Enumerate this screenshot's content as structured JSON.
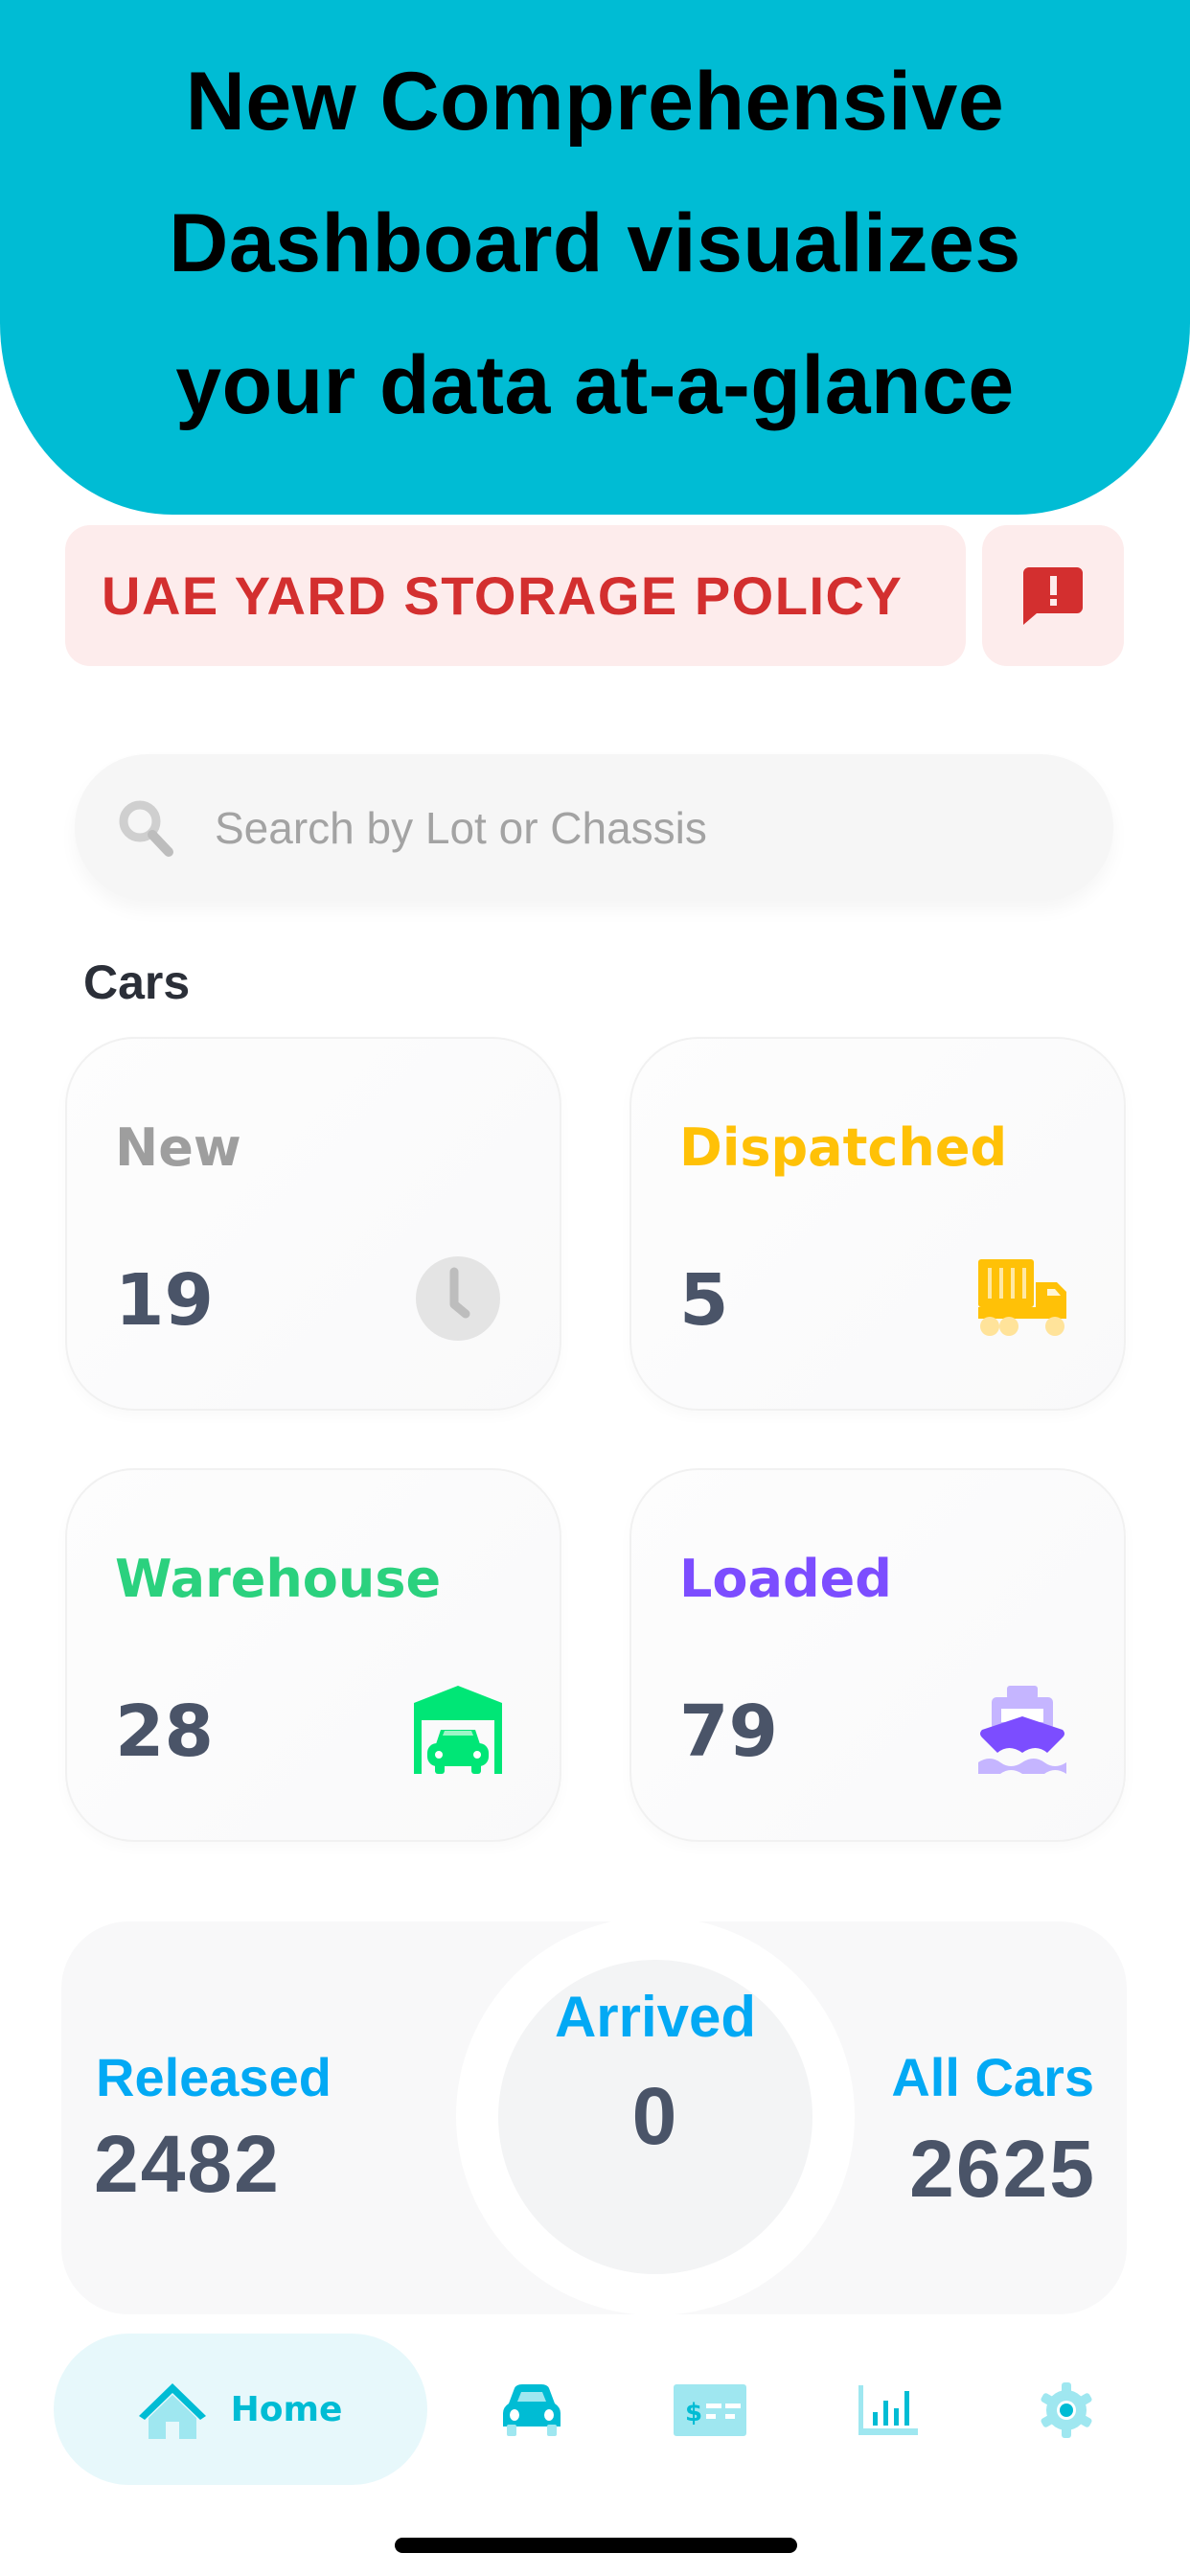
{
  "hero": {
    "lines": [
      "New Comprehensive",
      "Dashboard visualizes",
      "your data at-a-glance"
    ],
    "background": "#00BCD4"
  },
  "policy_banner": {
    "label": "UAE YARD STORAGE POLICY",
    "alert_icon": "alert-message-icon",
    "color": "#D32F2F"
  },
  "search": {
    "placeholder": "Search by Lot or Chassis",
    "value": "",
    "icon": "search-icon"
  },
  "cars": {
    "title": "Cars",
    "cards": [
      {
        "label": "New",
        "value": "19",
        "color": "#9E9E9E",
        "icon": "clock-icon"
      },
      {
        "label": "Dispatched",
        "value": "5",
        "color": "#FFC107",
        "icon": "truck-icon"
      },
      {
        "label": "Warehouse",
        "value": "28",
        "color": "#2BD17E",
        "icon": "garage-icon"
      },
      {
        "label": "Loaded",
        "value": "79",
        "color": "#7C4DFF",
        "icon": "ship-icon"
      }
    ],
    "summary": {
      "released": {
        "label": "Released",
        "value": "2482"
      },
      "arrived": {
        "label": "Arrived",
        "value": "0"
      },
      "all_cars": {
        "label": "All Cars",
        "value": "2625"
      }
    }
  },
  "nav": {
    "items": [
      {
        "label": "Home",
        "icon": "home-icon",
        "active": true
      },
      {
        "label": "",
        "icon": "car-icon",
        "active": false
      },
      {
        "label": "",
        "icon": "invoice-icon",
        "active": false
      },
      {
        "label": "",
        "icon": "bar-chart-icon",
        "active": false
      },
      {
        "label": "",
        "icon": "gear-icon",
        "active": false
      }
    ],
    "accent": "#00BCD4"
  }
}
